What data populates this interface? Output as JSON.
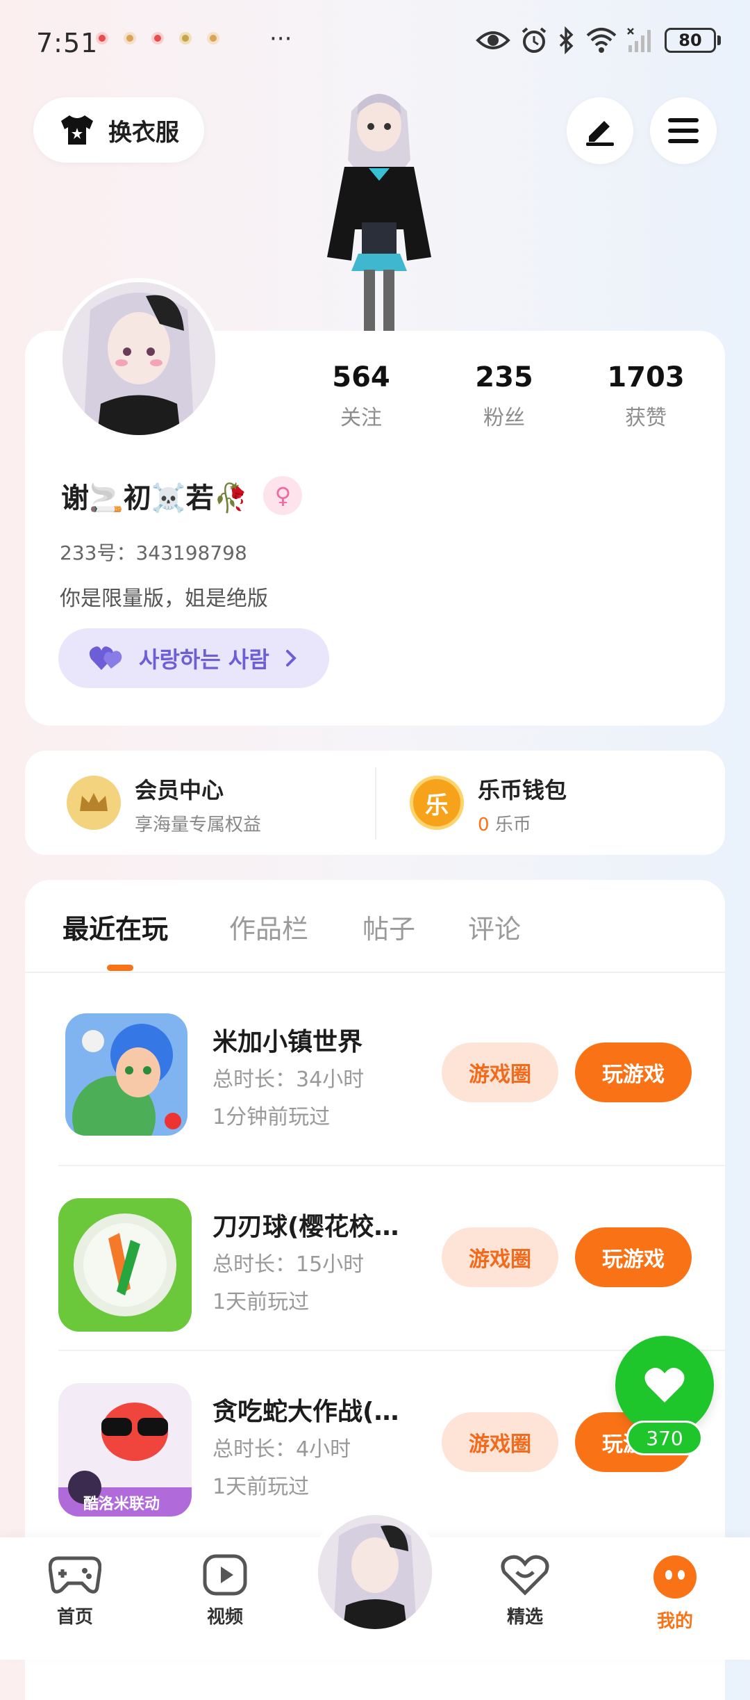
{
  "status_bar": {
    "time": "7:51",
    "more": "···",
    "battery": "80",
    "dot_colors": [
      "#e84d4d",
      "#d9a35a",
      "#e84d4d",
      "#c7a34a",
      "#d9a35a"
    ]
  },
  "header": {
    "outfit_label": "换衣服"
  },
  "profile": {
    "stats": [
      {
        "value": "564",
        "label": "关注"
      },
      {
        "value": "235",
        "label": "粉丝"
      },
      {
        "value": "1703",
        "label": "获赞"
      }
    ],
    "nickname": "谢🚬初☠️若🥀",
    "gender_symbol": "♀",
    "uid": "233号：343198798",
    "bio": "你是限量版，姐是绝版",
    "love_label": "사랑하는 사람"
  },
  "membership": {
    "vip_title": "会员中心",
    "vip_sub": "享海量专属权益",
    "wallet_icon_text": "乐",
    "wallet_title": "乐币钱包",
    "wallet_amount": "0",
    "wallet_unit": "乐币"
  },
  "tabs": [
    {
      "label": "最近在玩",
      "active": true
    },
    {
      "label": "作品栏",
      "active": false
    },
    {
      "label": "帖子",
      "active": false
    },
    {
      "label": "评论",
      "active": false
    }
  ],
  "games": [
    {
      "name": "米加小镇世界",
      "duration": "总时长：34小时",
      "last_played": "1分钟前玩过",
      "circle_btn": "游戏圈",
      "play_btn": "玩游戏"
    },
    {
      "name": "刀刃球(樱花校…",
      "duration": "总时长：15小时",
      "last_played": "1天前玩过",
      "circle_btn": "游戏圈",
      "play_btn": "玩游戏"
    },
    {
      "name": "贪吃蛇大作战(…",
      "duration": "总时长：4小时",
      "last_played": "1天前玩过",
      "circle_btn": "游戏圈",
      "play_btn": "玩游戏",
      "badge": "酷洛米联动"
    }
  ],
  "float_like": {
    "count": "370"
  },
  "bottom_nav": [
    {
      "label": "首页",
      "icon": "gamepad-icon"
    },
    {
      "label": "视频",
      "icon": "video-icon"
    },
    {
      "label": "精选",
      "icon": "heart-badge-icon"
    },
    {
      "label": "我的",
      "icon": "profile-face-icon",
      "active": true
    }
  ],
  "colors": {
    "accent": "#f97316",
    "love_purple": "#6d5ed8",
    "like_green": "#1ec62c"
  }
}
